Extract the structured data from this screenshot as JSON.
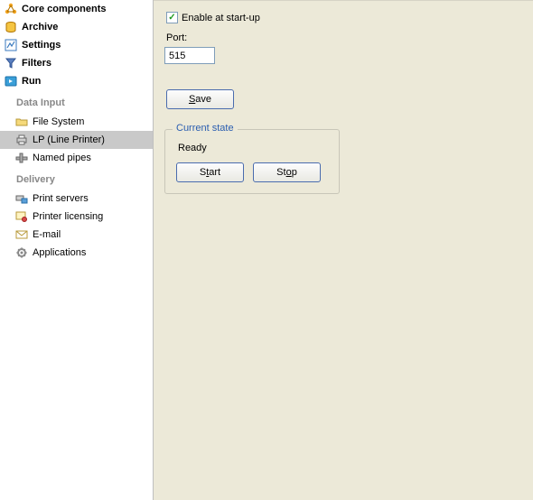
{
  "sidebar": {
    "top": [
      {
        "label": "Core components"
      },
      {
        "label": "Archive"
      },
      {
        "label": "Settings"
      },
      {
        "label": "Filters"
      },
      {
        "label": "Run"
      }
    ],
    "section1_label": "Data Input",
    "section1_items": [
      {
        "label": "File System"
      },
      {
        "label": "LP (Line Printer)"
      },
      {
        "label": "Named pipes"
      }
    ],
    "section2_label": "Delivery",
    "section2_items": [
      {
        "label": "Print servers"
      },
      {
        "label": "Printer licensing"
      },
      {
        "label": "E-mail"
      },
      {
        "label": "Applications"
      }
    ]
  },
  "main": {
    "enable_label": "Enable at start-up",
    "enable_checked": true,
    "port_label": "Port:",
    "port_value": "515",
    "save_label_pre": "",
    "save_label_u": "S",
    "save_label_post": "ave",
    "group_legend": "Current state",
    "status_text": "Ready",
    "start_label_pre": "S",
    "start_label_u": "t",
    "start_label_post": "art",
    "stop_label_pre": "St",
    "stop_label_u": "o",
    "stop_label_post": "p"
  }
}
